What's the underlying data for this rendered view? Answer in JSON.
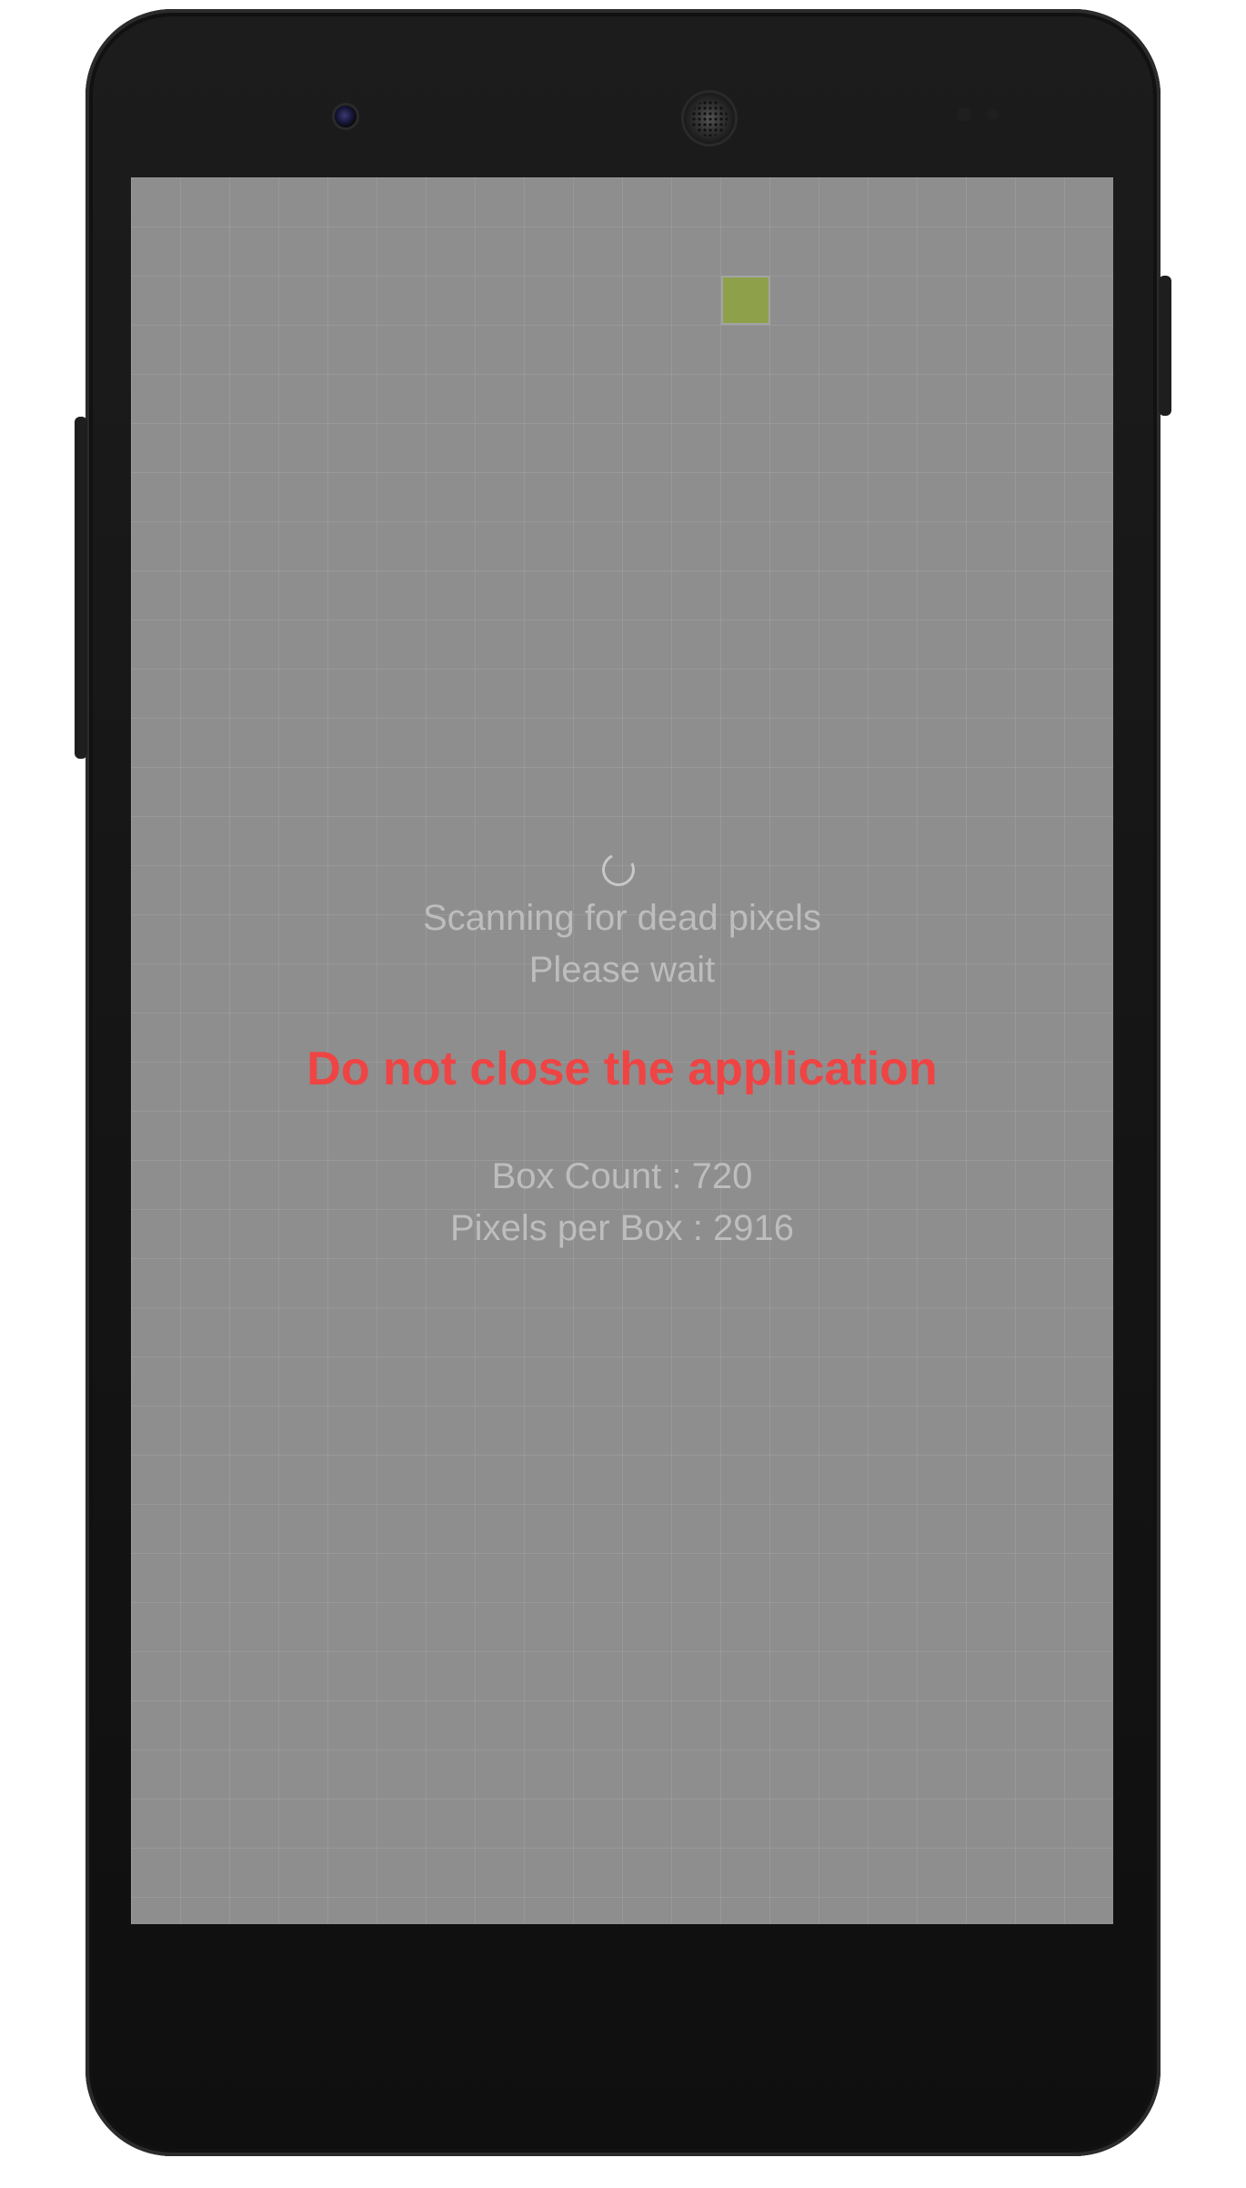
{
  "device": {
    "name": "android-phone"
  },
  "screen": {
    "background_color": "#8e8e8e",
    "active_box_color": "#8ea04a",
    "status": {
      "line1": "Scanning for dead pixels",
      "line2": "Please wait"
    },
    "warning": {
      "text": "Do not close the application",
      "color": "#ef4444"
    },
    "stats": {
      "box_count": "Box Count : 720",
      "pixels_per_box": "Pixels per Box : 2916"
    },
    "spinner_icon": "loading-spinner-icon"
  }
}
